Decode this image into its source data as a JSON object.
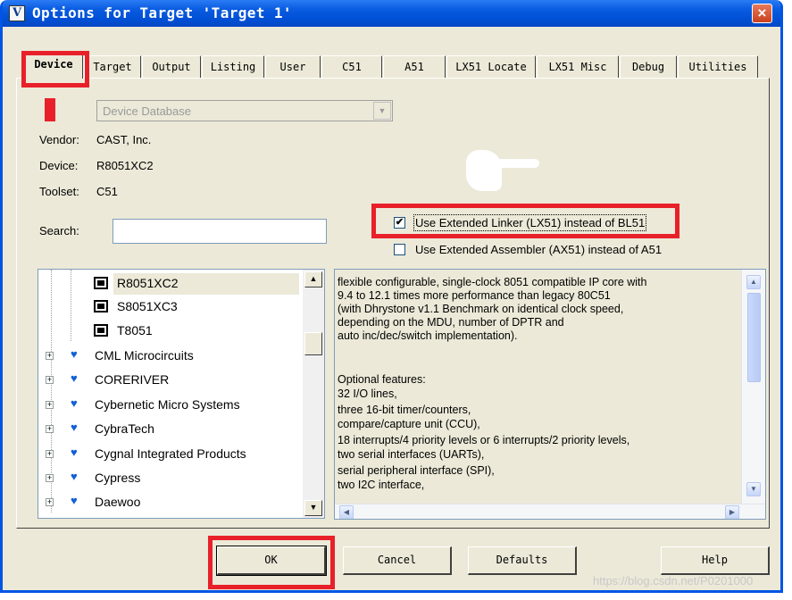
{
  "window": {
    "title": "Options for Target 'Target 1'",
    "app_icon_letter": "V",
    "close_glyph": "×"
  },
  "tabs": [
    {
      "label": "Device",
      "active": true
    },
    {
      "label": "Target"
    },
    {
      "label": "Output"
    },
    {
      "label": "Listing"
    },
    {
      "label": "User"
    },
    {
      "label": "C51"
    },
    {
      "label": "A51"
    },
    {
      "label": "LX51 Locate"
    },
    {
      "label": "LX51 Misc"
    },
    {
      "label": "Debug"
    },
    {
      "label": "Utilities"
    }
  ],
  "device": {
    "database": "Device Database",
    "vendor_label": "Vendor:",
    "vendor": "CAST, Inc.",
    "device_label": "Device:",
    "device": "R8051XC2",
    "toolset_label": "Toolset:",
    "toolset": "C51",
    "search_label": "Search:",
    "search_value": ""
  },
  "options": {
    "linker": {
      "label": "Use Extended Linker (LX51) instead of BL51",
      "checked": true
    },
    "assembler": {
      "label": "Use Extended Assembler (AX51) instead of A51",
      "checked": false
    }
  },
  "tree": {
    "devices": [
      "R8051XC2",
      "S8051XC3",
      "T8051"
    ],
    "vendors": [
      "CML Microcircuits",
      "CORERIVER",
      "Cybernetic Micro Systems",
      "CybraTech",
      "Cygnal Integrated Products",
      "Cypress",
      "Daewoo"
    ]
  },
  "description": [
    "flexible configurable, single-clock 8051 compatible IP core with",
    "9.4 to 12.1 times more performance than legacy 80C51",
    "(with Dhrystone v1.1 Benchmark on identical clock speed,",
    "depending on the MDU, number of  DPTR and",
    "auto inc/dec/switch implementation).",
    "",
    "Optional features:",
    "32 I/O lines,",
    "three 16-bit timer/counters,",
    "compare/capture unit (CCU),",
    "18 interrupts/4 priority levels or 6 interrupts/2 priority levels,",
    "two serial interfaces (UARTs),",
    "serial peripheral interface (SPI),",
    "two I2C interface,"
  ],
  "buttons": {
    "ok": "OK",
    "cancel": "Cancel",
    "defaults": "Defaults",
    "help": "Help"
  },
  "watermark": "https://blog.csdn.net/P0201000",
  "colors": {
    "accent": "#e8202a",
    "titlebar": "#0a5ce0",
    "face": "#ece9d8"
  }
}
